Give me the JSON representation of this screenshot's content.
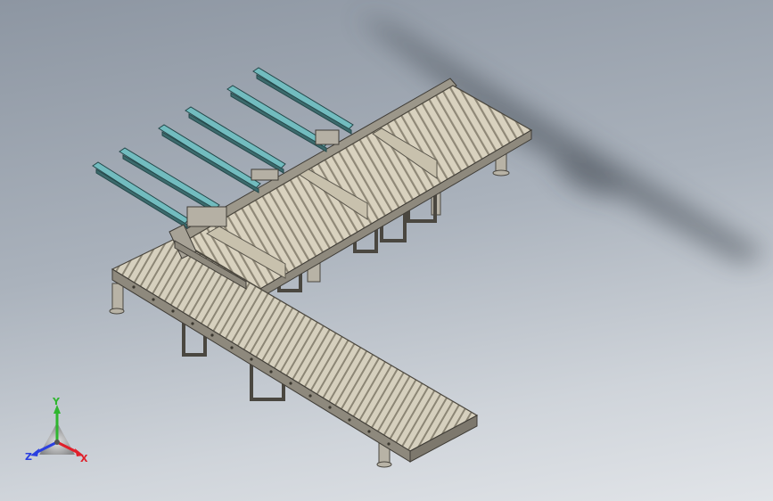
{
  "viewport": {
    "background_top": "#8d96a2",
    "background_bottom": "#e1e4e8"
  },
  "model": {
    "roller_color": "#cfc7b2",
    "frame_color": "#9e9a90",
    "beam_color": "#6fb3b5"
  },
  "triad": {
    "x_label": "X",
    "y_label": "Y",
    "z_label": "Z",
    "x_color": "#e0202a",
    "y_color": "#2fb62f",
    "z_color": "#2a3fe0"
  }
}
